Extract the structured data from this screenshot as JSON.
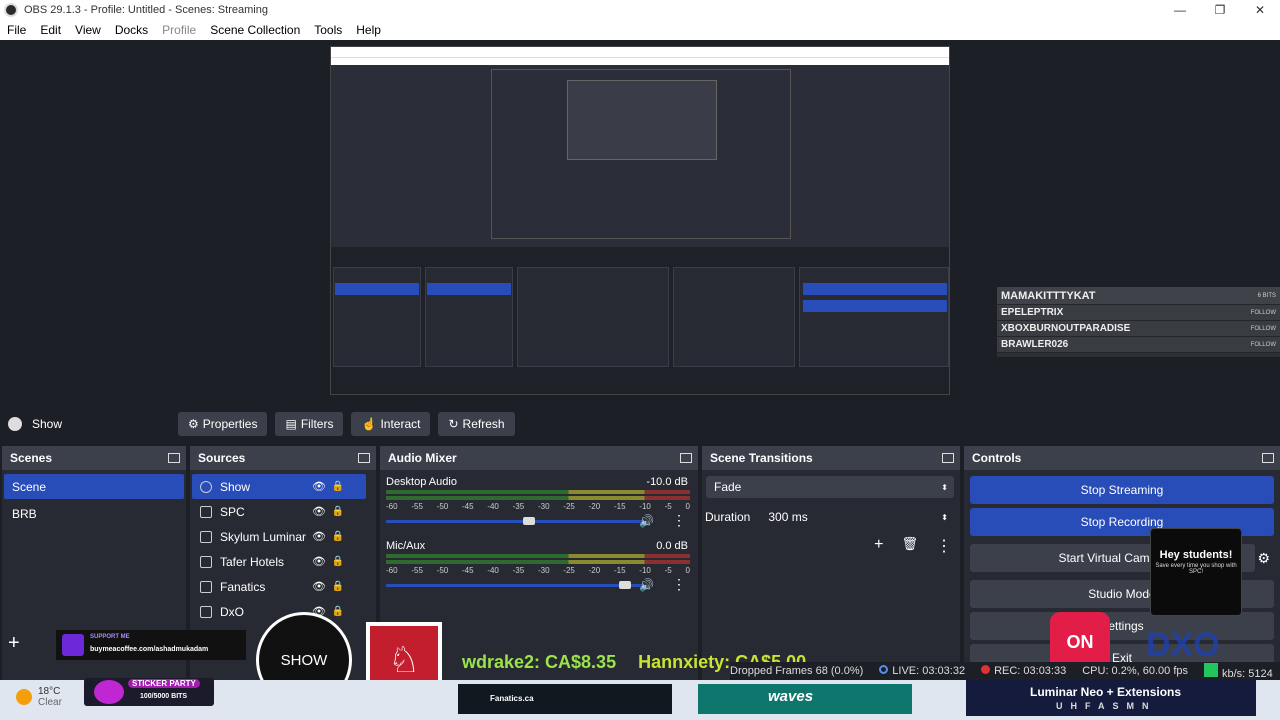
{
  "window": {
    "title": "OBS 29.1.3 - Profile: Untitled - Scenes: Streaming"
  },
  "menu": [
    "File",
    "Edit",
    "View",
    "Docks",
    "Profile",
    "Scene Collection",
    "Tools",
    "Help"
  ],
  "chat": {
    "header": "MAMAKITTTYKAT",
    "header_right": "6 BITS",
    "rows": [
      {
        "name": "EPELEPTRIX",
        "action": "FOLLOW"
      },
      {
        "name": "XBOXBURNOUTPARADISE",
        "action": "FOLLOW"
      },
      {
        "name": "BRAWLER026",
        "action": "FOLLOW"
      }
    ]
  },
  "toolbar": {
    "current_scene": "Show",
    "properties": "Properties",
    "filters": "Filters",
    "interact": "Interact",
    "refresh": "Refresh"
  },
  "scenes": {
    "title": "Scenes",
    "items": [
      "Scene",
      "BRB"
    ]
  },
  "sources": {
    "title": "Sources",
    "items": [
      "Show",
      "SPC",
      "Skylum Luminar",
      "Tafer Hotels",
      "Fanatics",
      "DxO"
    ]
  },
  "mixer": {
    "title": "Audio Mixer",
    "ticks": [
      "-60",
      "-55",
      "-50",
      "-45",
      "-40",
      "-35",
      "-30",
      "-25",
      "-20",
      "-15",
      "-10",
      "-5",
      "0"
    ],
    "channels": [
      {
        "name": "Desktop Audio",
        "db": "-10.0 dB",
        "level": 0.55
      },
      {
        "name": "Mic/Aux",
        "db": "0.0 dB",
        "level": 0.92
      }
    ]
  },
  "transitions": {
    "title": "Scene Transitions",
    "type": "Fade",
    "duration_label": "Duration",
    "duration_value": "300 ms"
  },
  "controls": {
    "title": "Controls",
    "buttons": [
      "Stop Streaming",
      "Stop Recording",
      "Start Virtual Camera",
      "Studio Mode",
      "Settings",
      "Exit"
    ]
  },
  "overlay": {
    "support_title": "SUPPORT ME",
    "support_url": "buymeacoffee.com/ashadmukadam",
    "show_logo": "SHOW",
    "ticker_1": "wdrake2: CA$8.35",
    "ticker_2": "Hannxiety: CA$5.00",
    "sticker_title": "STICKER PARTY",
    "sticker_bits": "100/5000 BITS",
    "hey_title": "Hey students!",
    "hey_sub": "Save every time you shop with SPC!",
    "on_logo": "ON",
    "dxo": "DXO"
  },
  "status": {
    "dropped": "Dropped Frames 68 (0.0%)",
    "live": "LIVE: 03:03:32",
    "rec": "REC: 03:03:33",
    "cpu": "CPU: 0.2%, 60.00 fps",
    "kbps": "kb/s: 5124"
  },
  "weather": {
    "temp": "18°C",
    "cond": "Clear"
  },
  "ads": {
    "fanatics": "Fanatics.ca",
    "waves": "waves",
    "luminar": "Luminar Neo + Extensions",
    "luminar_sub": "UHFASMN"
  }
}
